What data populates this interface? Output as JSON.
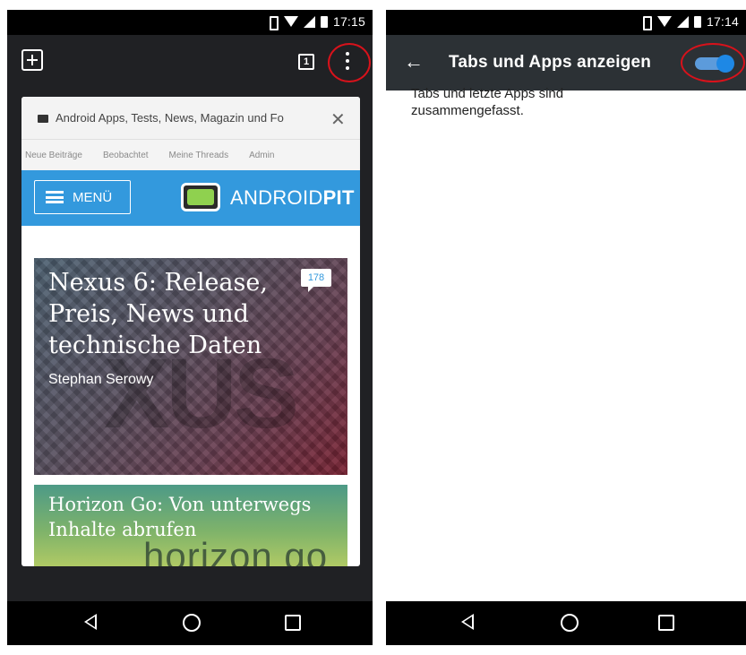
{
  "left_screen": {
    "status_bar": {
      "time": "17:15"
    },
    "toolbar": {
      "new_tab_icon": "plus-icon",
      "tab_count": "1",
      "menu_icon": "overflow-menu-icon"
    },
    "tab_card": {
      "title": "Android Apps, Tests, News, Magazin und Fo",
      "close_icon": "close-icon",
      "site_nav": [
        "Neue Beiträge",
        "Beobachtet",
        "Meine Threads",
        "Admin"
      ],
      "menu_label": "MENÜ",
      "brand_prefix": "ANDROID",
      "brand_suffix": "PIT",
      "articles": [
        {
          "title": "Nexus 6: Release, Preis, News und technische Daten",
          "author": "Stephan Serowy",
          "comments": "178"
        },
        {
          "title": "Horizon Go: Von unterwegs Inhalte abrufen",
          "logo_text": "horizon go"
        }
      ]
    },
    "highlight_color": "#d8121b"
  },
  "right_screen": {
    "status_bar": {
      "time": "17:14"
    },
    "toolbar": {
      "back_icon": "back-arrow-icon",
      "title": "Tabs und Apps anzeigen",
      "toggle_on": true
    },
    "description": "Tabs und letzte Apps sind zusammengefasst.",
    "accent_color": "#1e88e5"
  },
  "nav_bar": {
    "back_icon": "back-triangle-icon",
    "home_icon": "home-circle-icon",
    "recents_icon": "recents-square-icon"
  }
}
